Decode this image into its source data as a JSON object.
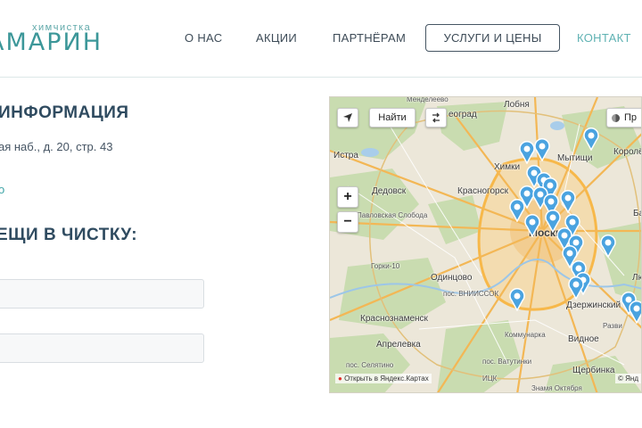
{
  "header": {
    "logo_subtitle": "химчистка",
    "logo_title": "АМАРИН",
    "nav": {
      "about": "О НАС",
      "promotions": "АКЦИИ",
      "partners": "ПАРТНЁРАМ",
      "services": "УСЛУГИ И ЦЕНЫ",
      "contacts": "КОНТАКТ"
    }
  },
  "info": {
    "title": "ИНФОРМАЦИЯ",
    "address": "ая наб., д. 20, стр. 43",
    "link_fragment": "о"
  },
  "order": {
    "title": "ЕЩИ В ЧИСТКУ:"
  },
  "map": {
    "find_button": "Найти",
    "layers_button": "Пр",
    "zoom_in": "+",
    "zoom_out": "−",
    "open_in_yandex": "Открыть в Яндекс.Картах",
    "copyright": "© Янд",
    "labels": {
      "mendeleevo": "Менделеево",
      "lobnya": "Лобня",
      "zelenograd": "еоград",
      "istra": "Истра",
      "khimki": "Химки",
      "mytishchi": "Мытищи",
      "korolev": "Королё",
      "dedovsk": "Дедовск",
      "krasnogorsk": "Красногорск",
      "moskva": "Москва",
      "odintsovo": "Одинцово",
      "krasnoznamensk": "Краснознаменск",
      "aprelevka": "Апрелевка",
      "dzerzhinsky": "Дзержинский",
      "vidnoe": "Видное",
      "shcherbinka": "Щербинка",
      "kommunarka": "Коммунарка",
      "lyuberts": "Любе",
      "balash": "Ба",
      "gorki10": "Горки-10",
      "pavl_sloboda": "Павловская Слобода",
      "vniissok": "пос. ВНИИССОК",
      "selyatino": "пос. Селятино",
      "vatutinki": "пос. Ватутинки",
      "znamya": "Знамя Октября",
      "razvi": "Разви",
      "ikts": "ИЦК"
    }
  },
  "colors": {
    "accent": "#3c9799",
    "heading": "#2f4b60",
    "pin": "#4aa3e0"
  }
}
